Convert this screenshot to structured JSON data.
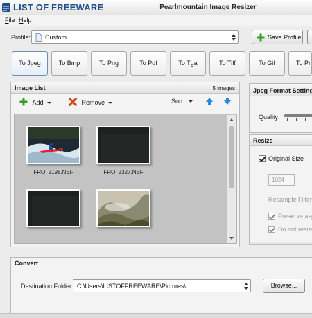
{
  "app": {
    "logo_text": "LIST OF FREEWARE",
    "window_title": "Pearlmountain Image Resizer"
  },
  "menu": [
    {
      "label": "File"
    },
    {
      "label": "Help"
    }
  ],
  "profile": {
    "label": "Profile:",
    "value": "Custom"
  },
  "save_profile": {
    "label": "Save Profile"
  },
  "formats": [
    {
      "label": "To Jpeg",
      "active": true
    },
    {
      "label": "To Bmp"
    },
    {
      "label": "To Png"
    },
    {
      "label": "To Pdf"
    },
    {
      "label": "To Tga"
    },
    {
      "label": "To Tiff"
    },
    {
      "label": "To Gif"
    },
    {
      "label": "To Pn"
    }
  ],
  "image_list": {
    "title": "Image List",
    "count": "5 images",
    "toolbar": {
      "add": "Add",
      "remove": "Remove",
      "sort": "Sort"
    },
    "items": [
      {
        "name": "FRO_2198.NEF",
        "thumb": "kayak-icon"
      },
      {
        "name": "FRO_2327.NEF",
        "thumb": "dark-photo-icon"
      },
      {
        "name": "",
        "thumb": "dark-photo-icon"
      },
      {
        "name": "",
        "thumb": "foggy-landscape-icon"
      }
    ]
  },
  "jpeg_settings": {
    "title": "Jpeg Format Setting",
    "quality_label": "Quality:"
  },
  "resize": {
    "title": "Resize",
    "original_size": {
      "label": "Original Size",
      "checked": true
    },
    "width_value": "1024",
    "resample_filter": "Resample Filter",
    "preserve_aspect": {
      "label": "Preserve asp",
      "checked": true
    },
    "do_not_resize": {
      "label": "Do not resize",
      "checked": true
    }
  },
  "convert": {
    "title": "Convert",
    "destination_label": "Destination Folder:",
    "destination_value": "C:\\Users\\LISTOFFREEWARE\\Pictures\\",
    "browse_label": "Browse..."
  },
  "colors": {
    "accent_blue": "#1f4f86",
    "add_green": "#3a9a2a",
    "remove_red": "#d2461c",
    "arrow_blue": "#2f86e0"
  }
}
